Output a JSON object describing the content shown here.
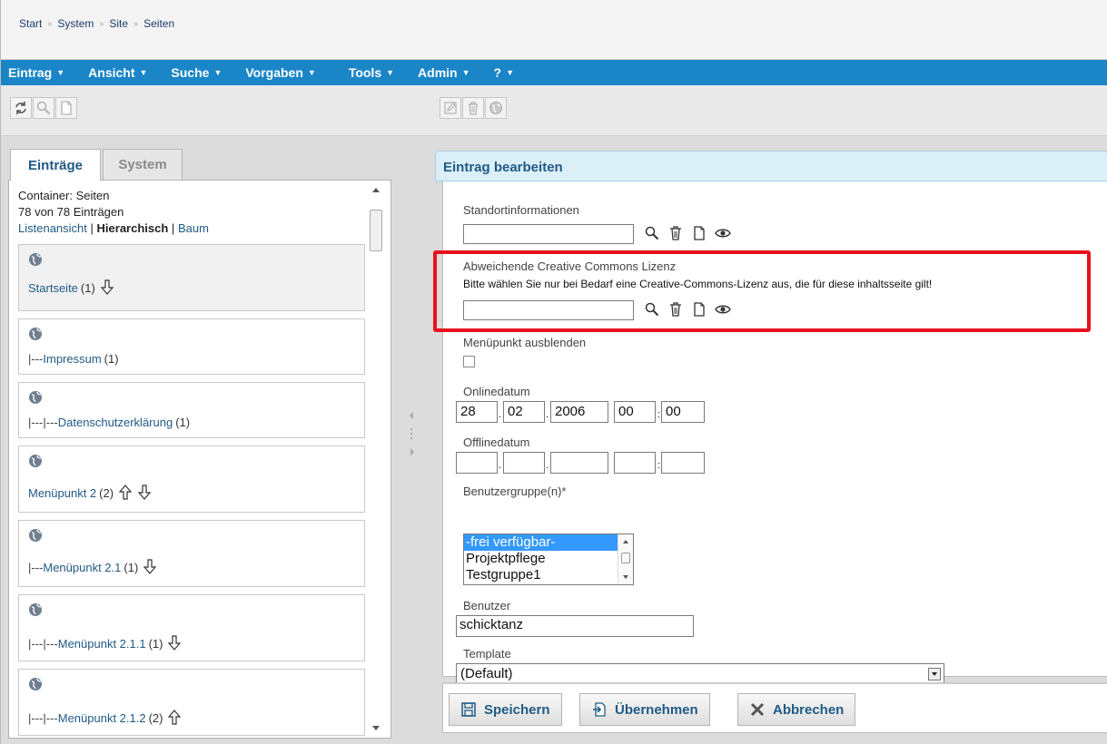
{
  "breadcrumb": [
    "Start",
    "System",
    "Site",
    "Seiten"
  ],
  "menu": [
    "Eintrag",
    "Ansicht",
    "Suche",
    "Vorgaben",
    "Tools",
    "Admin",
    "?"
  ],
  "left_panel": {
    "tabs": [
      "Einträge",
      "System"
    ],
    "container_label": "Container: Seiten",
    "count_text": "78 von 78 Einträgen",
    "views": [
      "Listenansicht",
      "Hierarchisch",
      "Baum"
    ],
    "view_sep": "|",
    "entries": [
      {
        "prefix": "",
        "label": "Startseite",
        "count": "(1)",
        "arrows": [
          "down"
        ]
      },
      {
        "prefix": "|---",
        "label": "Impressum",
        "count": "(1)",
        "arrows": []
      },
      {
        "prefix": "|---|---",
        "label": "Datenschutzerklärung",
        "count": "(1)",
        "arrows": []
      },
      {
        "prefix": "",
        "label": "Menüpunkt 2",
        "count": "(2)",
        "arrows": [
          "up",
          "down"
        ]
      },
      {
        "prefix": "|---",
        "label": "Menüpunkt 2.1",
        "count": "(1)",
        "arrows": [
          "down"
        ]
      },
      {
        "prefix": "|---|---",
        "label": "Menüpunkt 2.1.1",
        "count": "(1)",
        "arrows": [
          "down"
        ]
      },
      {
        "prefix": "|---|---",
        "label": "Menüpunkt 2.1.2",
        "count": "(2)",
        "arrows": [
          "up"
        ]
      }
    ]
  },
  "right_panel": {
    "title": "Eintrag bearbeiten",
    "standort_label": "Standortinformationen",
    "standort_value": "",
    "cc_label": "Abweichende Creative Commons Lizenz",
    "cc_hint": "Bitte wählen Sie nur bei Bedarf eine Creative-Commons-Lizenz aus, die für diese inhaltsseite gilt!",
    "cc_value": "",
    "hide_label": "Menüpunkt ausblenden",
    "hide_checked": false,
    "online_label": "Onlinedatum",
    "online": {
      "day": "28",
      "month": "02",
      "year": "2006",
      "hour": "00",
      "minute": "00"
    },
    "offline_label": "Offlinedatum",
    "offline": {
      "day": "",
      "month": "",
      "year": "",
      "hour": "",
      "minute": ""
    },
    "date_sep": ".",
    "time_sep": ":",
    "groups_label": "Benutzergruppe(n)*",
    "groups": [
      "-frei verfügbar-",
      "Projektpflege",
      "Testgruppe1"
    ],
    "groups_selected": "-frei verfügbar-",
    "user_label": "Benutzer",
    "user_value": "schicktanz",
    "template_label": "Template",
    "template_value": "(Default)",
    "buttons": {
      "save": "Speichern",
      "apply": "Übernehmen",
      "cancel": "Abbrechen"
    }
  },
  "colors": {
    "menubar": "#1a86c8",
    "highlight": "#e8121c",
    "link": "#1f5a85",
    "header_bg": "#dbeff8",
    "selection": "#3399ff"
  }
}
